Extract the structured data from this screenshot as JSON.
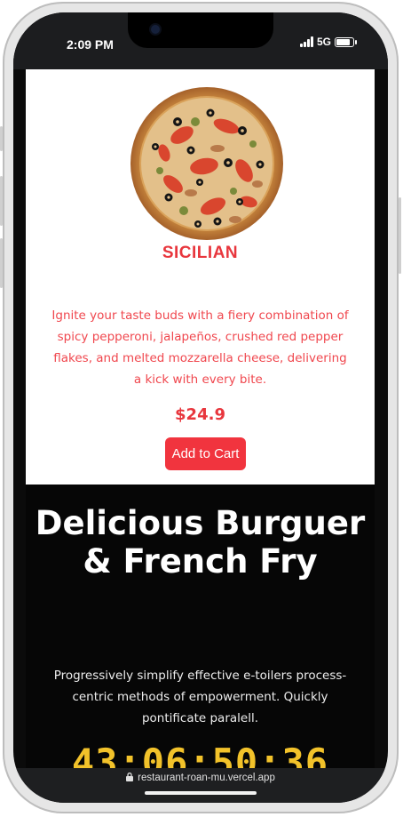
{
  "status_bar": {
    "time": "2:09 PM",
    "network": "5G"
  },
  "product": {
    "name": "SICILIAN",
    "description": "Ignite your taste buds with a fiery combination of spicy pepperoni, jalapeños, crushed red pepper flakes, and melted mozzarella cheese, delivering a kick with every bite.",
    "price": "$24.9",
    "add_to_cart_label": "Add to Cart",
    "image_icon": "pizza-image"
  },
  "promo": {
    "title": "Delicious Burguer & French Fry",
    "text": "Progressively simplify effective e-toilers process-centric methods of empowerment. Quickly pontificate paralell.",
    "countdown": "43:06:50:36"
  },
  "browser": {
    "url": "restaurant-roan-mu.vercel.app"
  },
  "colors": {
    "accent": "#f1343e",
    "countdown": "#f2c22a",
    "promo_bg": "#060606"
  }
}
